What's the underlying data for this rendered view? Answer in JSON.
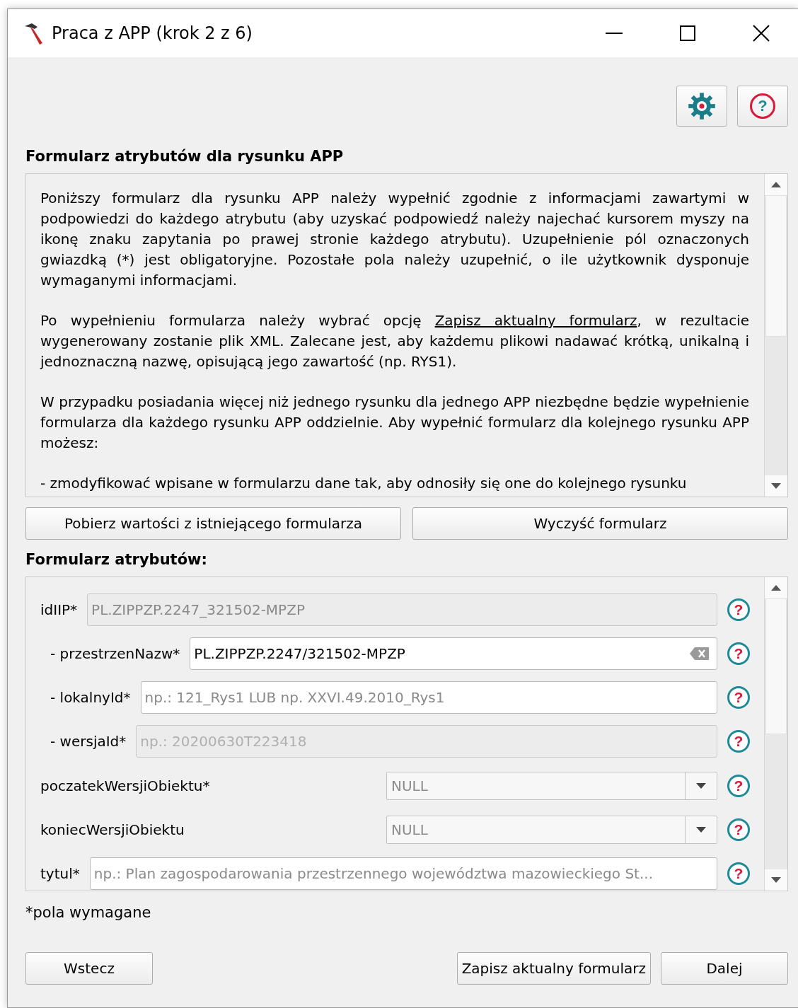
{
  "window": {
    "title": "Praca z APP (krok 2 z 6)"
  },
  "toolbar": [
    {
      "kind": "settings"
    },
    {
      "kind": "help",
      "label": "?"
    }
  ],
  "intro": {
    "heading": "Formularz atrybutów dla rysunku APP",
    "paragraphs": [
      {
        "text": "Poniższy formularz dla rysunku APP należy wypełnić zgodnie z informacjami zawartymi w podpowiedzi do każdego atrybutu (aby uzyskać podpowiedź należy najechać kursorem myszy na ikonę znaku zapytania po prawej stronie każdego atrybutu). Uzupełnienie pól oznaczonych gwiazdką (*) jest obligatoryjne. Pozostałe pola należy uzupełnić, o ile użytkownik dysponuje wymaganymi informacjami."
      },
      {
        "text": "Po wypełnieniu formularza należy wybrać opcję ",
        "link": "Zapisz aktualny formularz",
        "after": ", w rezultacie wygenerowany zostanie plik XML. Zalecane jest, aby każdemu plikowi nadawać krótką, unikalną i jednoznaczną nazwę, opisującą jego zawartość (np. RYS1)."
      },
      {
        "text": "W przypadku posiadania więcej niż jednego rysunku dla jednego APP niezbędne będzie wypełnienie formularza dla każdego rysunku APP oddzielnie. Aby wypełnić formularz dla kolejnego rysunku APP możesz:"
      },
      {
        "text": "- zmodyfikować wpisane w formularzu dane tak, aby odnosiły się one do kolejnego rysunku"
      }
    ]
  },
  "intro_buttons": [
    "Pobierz wartości z istniejącego formularza",
    "Wyczyść formularz"
  ],
  "form": {
    "heading": "Formularz atrybutów:",
    "rows": [
      {
        "label": "idIIP*",
        "kind": "text",
        "value": "PL.ZIPPZP.2247_321502-MPZP",
        "disabled": true,
        "clearable": false,
        "help": "?",
        "children": [
          {
            "label": "- przestrzenNazw*",
            "kind": "text",
            "value": "PL.ZIPPZP.2247/321502-MPZP",
            "disabled": false,
            "clearable": true,
            "help": "?"
          },
          {
            "label": "- lokalnyId*",
            "kind": "text",
            "placeholder": "np.: 121_Rys1 LUB np. XXVI.49.2010_Rys1",
            "disabled": false,
            "clearable": false,
            "help": "?"
          },
          {
            "label": "- wersjaId*",
            "kind": "text",
            "placeholder": "np.: 20200630T223418",
            "disabled": true,
            "clearable": false,
            "help": "?"
          }
        ]
      },
      {
        "label": "poczatekWersjiObiektu*",
        "kind": "combo",
        "value": "NULL",
        "help": "?"
      },
      {
        "label": "koniecWersjiObiektu",
        "kind": "combo",
        "value": "NULL",
        "help": "?"
      },
      {
        "label": "tytul*",
        "kind": "text",
        "placeholder": "np.: Plan zagospodarowania przestrzennego województwa mazowieckiego St...",
        "disabled": false,
        "clearable": false,
        "help": "?"
      }
    ]
  },
  "required_note": "*pola wymagane",
  "footer": {
    "back": "Wstecz",
    "actions": [
      "Zapisz aktualny formularz",
      "Dalej"
    ]
  }
}
